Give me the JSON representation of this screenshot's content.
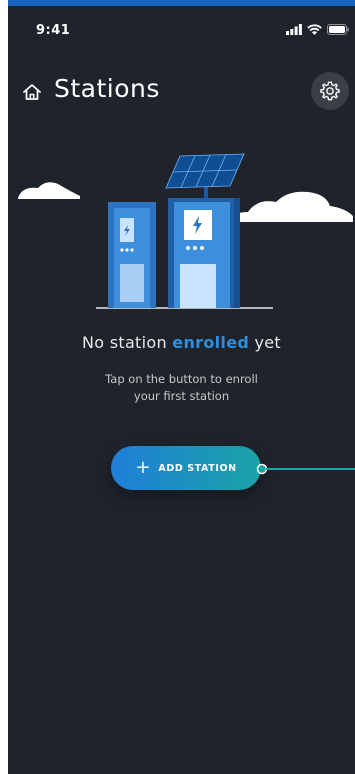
{
  "status_bar": {
    "time": "9:41"
  },
  "header": {
    "title": "Stations"
  },
  "empty_state": {
    "title_prefix": "No station ",
    "title_accent": "enrolled",
    "title_suffix": " yet",
    "subtitle_line1": "Tap on the button to enroll",
    "subtitle_line2": "your first station"
  },
  "actions": {
    "add_station_plus": "+",
    "add_station_label": "ADD STATION"
  },
  "icons": {
    "home": "home-icon",
    "settings": "gear-icon",
    "signal": "signal-icon",
    "wifi": "wifi-icon",
    "battery": "battery-icon"
  },
  "colors": {
    "background": "#1f232b",
    "accent": "#2e8ee0",
    "button_start": "#1f7fd8",
    "button_end": "#1aa3a6",
    "station_blue": "#2b74c2"
  }
}
